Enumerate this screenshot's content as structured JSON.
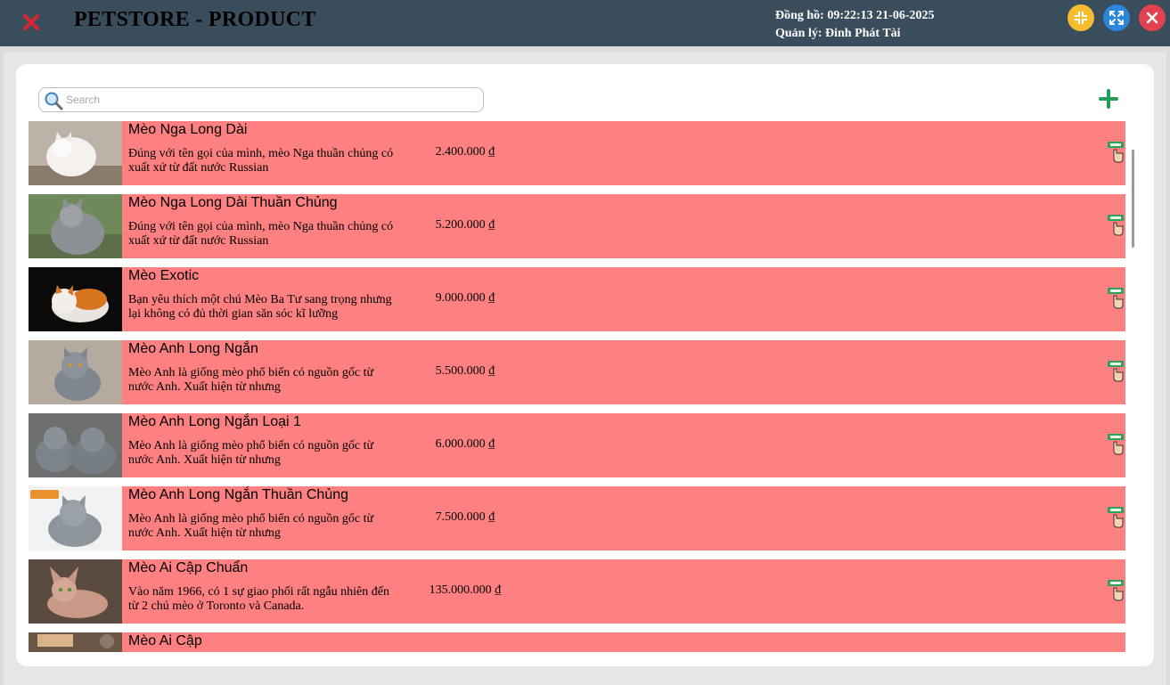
{
  "header": {
    "title": "PETSTORE - PRODUCT",
    "clock_label": "Đồng hồ:",
    "clock_value": "09:22:13 21-06-2025",
    "manager_label": "Quản lý:",
    "manager_value": "Đinh Phát Tài"
  },
  "search": {
    "placeholder": "Search",
    "value": ""
  },
  "products": [
    {
      "name": "Mèo Nga Long Dài",
      "desc": "Đúng với tên gọi của mình, mèo Nga thuần chủng có xuất xứ từ đất nước Russian",
      "price": "2.400.000 ₫"
    },
    {
      "name": "Mèo Nga Long Dài Thuần Chủng",
      "desc": "Đúng với tên gọi của mình, mèo Nga thuần chủng có xuất xứ từ đất nước Russian",
      "price": "5.200.000 ₫"
    },
    {
      "name": "Mèo Exotic",
      "desc": "Bạn yêu thích một chú Mèo Ba Tư sang trọng nhưng lại không có đủ thời gian săn sóc kĩ lưỡng",
      "price": "9.000.000 ₫"
    },
    {
      "name": "Mèo Anh Long Ngắn",
      "desc": "Mèo Anh là giống mèo phổ biến có nguồn gốc từ nước Anh. Xuất hiện từ nhưng",
      "price": "5.500.000 ₫"
    },
    {
      "name": "Mèo Anh Long Ngắn Loại 1",
      "desc": "Mèo Anh là giống mèo phổ biến có nguồn gốc từ nước Anh. Xuất hiện từ nhưng",
      "price": "6.000.000 ₫"
    },
    {
      "name": "Mèo Anh Long Ngắn Thuần Chủng",
      "desc": "Mèo Anh là giống mèo phổ biến có nguồn gốc từ nước Anh. Xuất hiện từ nhưng",
      "price": "7.500.000 ₫"
    },
    {
      "name": "Mèo Ai Cập Chuẩn",
      "desc": "Vào năm 1966, có 1 sự giao phối rất ngẫu nhiên đến từ 2 chú mèo ở Toronto và Canada.",
      "price": "135.000.000 ₫"
    },
    {
      "name": "Mèo Ai Cập",
      "desc": "",
      "price": ""
    }
  ],
  "colors": {
    "header_bg": "#3a4d5c",
    "row_bg": "#fe8080",
    "minimize": "#f6bd2e",
    "maximize": "#2a86d8",
    "close": "#e2424d",
    "add": "#1f9e55"
  },
  "icons": {
    "close": "close-x-icon",
    "minimize": "minimize-icon",
    "maximize": "maximize-icon",
    "window_close": "window-close-icon",
    "search": "magnifier-icon",
    "add": "plus-icon",
    "sell": "sell-hand-icon"
  }
}
